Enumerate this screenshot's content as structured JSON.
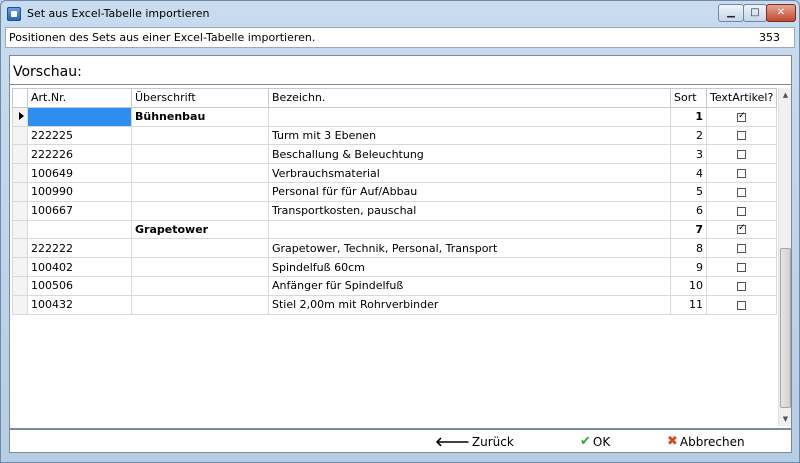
{
  "window": {
    "title": "Set aus Excel-Tabelle importieren"
  },
  "header": {
    "text": "Positionen des Sets aus einer Excel-Tabelle importieren.",
    "count": "353"
  },
  "preview": {
    "title": "Vorschau:"
  },
  "grid": {
    "columns": [
      "Art.Nr.",
      "Überschrift",
      "Bezeichn.",
      "Sort",
      "TextArtikel?"
    ],
    "rows": [
      {
        "artnr": "",
        "ueberschrift": "Bühnenbau",
        "bezeichnung": "",
        "sort": "1",
        "text_artikel": true
      },
      {
        "artnr": "222225",
        "ueberschrift": "",
        "bezeichnung": "Turm mit 3 Ebenen",
        "sort": "2",
        "text_artikel": false
      },
      {
        "artnr": "222226",
        "ueberschrift": "",
        "bezeichnung": "Beschallung & Beleuchtung",
        "sort": "3",
        "text_artikel": false
      },
      {
        "artnr": "100649",
        "ueberschrift": "",
        "bezeichnung": "Verbrauchsmaterial",
        "sort": "4",
        "text_artikel": false
      },
      {
        "artnr": "100990",
        "ueberschrift": "",
        "bezeichnung": "Personal für für Auf/Abbau",
        "sort": "5",
        "text_artikel": false
      },
      {
        "artnr": "100667",
        "ueberschrift": "",
        "bezeichnung": "Transportkosten, pauschal",
        "sort": "6",
        "text_artikel": false
      },
      {
        "artnr": "",
        "ueberschrift": "Grapetower",
        "bezeichnung": "",
        "sort": "7",
        "text_artikel": true
      },
      {
        "artnr": "222222",
        "ueberschrift": "",
        "bezeichnung": "Grapetower, Technik, Personal, Transport",
        "sort": "8",
        "text_artikel": false
      },
      {
        "artnr": "100402",
        "ueberschrift": "",
        "bezeichnung": "Spindelfuß 60cm",
        "sort": "9",
        "text_artikel": false
      },
      {
        "artnr": "100506",
        "ueberschrift": "",
        "bezeichnung": "Anfänger für Spindelfuß",
        "sort": "10",
        "text_artikel": false
      },
      {
        "artnr": "100432",
        "ueberschrift": "",
        "bezeichnung": "Stiel 2,00m mit Rohrverbinder",
        "sort": "11",
        "text_artikel": false
      }
    ]
  },
  "buttons": {
    "back": "Zurück",
    "ok": "OK",
    "cancel": "Abbrechen"
  },
  "icons": {
    "back": "arrow-left-icon",
    "ok": "checkmark-icon",
    "cancel": "cross-icon"
  },
  "colors": {
    "selection": "#2e8ef0",
    "ok_icon": "#3aa52e",
    "cancel_icon": "#e04020"
  }
}
